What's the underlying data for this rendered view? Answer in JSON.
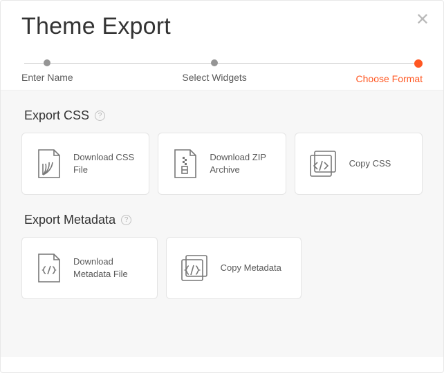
{
  "header": {
    "title": "Theme Export"
  },
  "steps": {
    "0": {
      "label": "Enter Name"
    },
    "1": {
      "label": "Select Widgets"
    },
    "2": {
      "label": "Choose Format"
    }
  },
  "sections": {
    "css": {
      "title": "Export CSS",
      "cards": {
        "download_css": "Download CSS File",
        "download_zip": "Download ZIP Archive",
        "copy_css": "Copy CSS"
      }
    },
    "metadata": {
      "title": "Export Metadata",
      "cards": {
        "download_meta": "Download Metadata File",
        "copy_meta": "Copy Metadata"
      }
    }
  }
}
